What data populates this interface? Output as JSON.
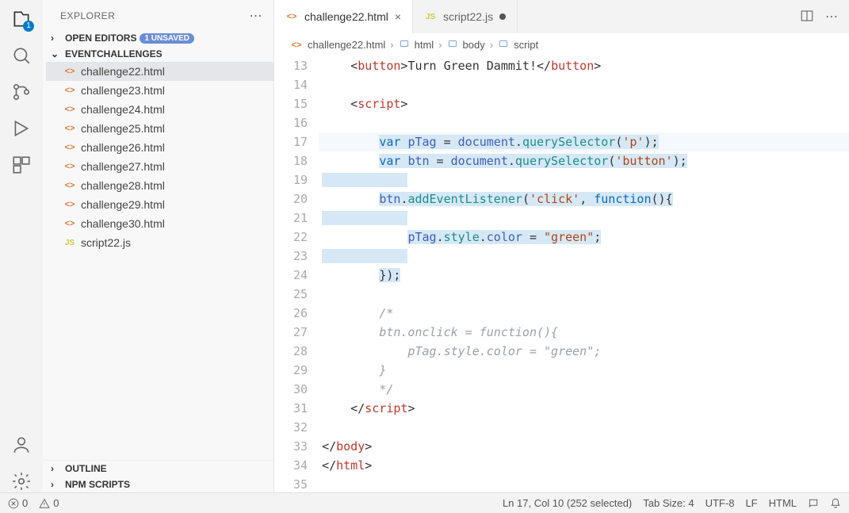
{
  "sidebar": {
    "title": "EXPLORER",
    "openEditors": "OPEN EDITORS",
    "unsaved": "1 UNSAVED",
    "folder": "EVENTCHALLENGES",
    "files": [
      {
        "name": "challenge22.html",
        "type": "html",
        "selected": true
      },
      {
        "name": "challenge23.html",
        "type": "html"
      },
      {
        "name": "challenge24.html",
        "type": "html"
      },
      {
        "name": "challenge25.html",
        "type": "html"
      },
      {
        "name": "challenge26.html",
        "type": "html"
      },
      {
        "name": "challenge27.html",
        "type": "html"
      },
      {
        "name": "challenge28.html",
        "type": "html"
      },
      {
        "name": "challenge29.html",
        "type": "html"
      },
      {
        "name": "challenge30.html",
        "type": "html"
      },
      {
        "name": "script22.js",
        "type": "js"
      }
    ],
    "outline": "OUTLINE",
    "npm": "NPM SCRIPTS"
  },
  "activityBadge": "1",
  "tabs": [
    {
      "name": "challenge22.html",
      "type": "html",
      "active": true,
      "dirty": false
    },
    {
      "name": "script22.js",
      "type": "js",
      "active": false,
      "dirty": true
    }
  ],
  "breadcrumb": [
    "challenge22.html",
    "html",
    "body",
    "script"
  ],
  "code": {
    "startLine": 13,
    "lines": [
      {
        "n": 13,
        "type": "buttonline"
      },
      {
        "n": 14,
        "type": "blank"
      },
      {
        "n": 15,
        "type": "scriptopen"
      },
      {
        "n": 16,
        "type": "blank-indent"
      },
      {
        "n": 17,
        "type": "l17"
      },
      {
        "n": 18,
        "type": "l18"
      },
      {
        "n": 19,
        "type": "blank-sel"
      },
      {
        "n": 20,
        "type": "l20"
      },
      {
        "n": 21,
        "type": "blank-sel"
      },
      {
        "n": 22,
        "type": "l22"
      },
      {
        "n": 23,
        "type": "blank-sel"
      },
      {
        "n": 24,
        "type": "l24"
      },
      {
        "n": 25,
        "type": "blank"
      },
      {
        "n": 26,
        "type": "c",
        "text": "/*"
      },
      {
        "n": 27,
        "type": "c",
        "text": "btn.onclick = function(){"
      },
      {
        "n": 28,
        "type": "c",
        "text": "    pTag.style.color = \"green\";"
      },
      {
        "n": 29,
        "type": "c",
        "text": "}"
      },
      {
        "n": 30,
        "type": "c",
        "text": "*/"
      },
      {
        "n": 31,
        "type": "scriptclose"
      },
      {
        "n": 32,
        "type": "blank"
      },
      {
        "n": 33,
        "type": "bodyclose"
      },
      {
        "n": 34,
        "type": "htmlclose"
      },
      {
        "n": 35,
        "type": "blank"
      }
    ],
    "tokens": {
      "button": "button",
      "turnGreen": "Turn Green Dammit!",
      "script": "script",
      "var": "var",
      "pTag": "pTag",
      "btn": "btn",
      "document": "document",
      "querySelector": "querySelector",
      "p": "'p'",
      "btnStr": "'button'",
      "addEventListener": "addEventListener",
      "click": "'click'",
      "function": "function",
      "style": "style",
      "color": "color",
      "green": "\"green\"",
      "body": "body",
      "html": "html"
    }
  },
  "status": {
    "errors": "0",
    "warnings": "0",
    "selection": "Ln 17, Col 10 (252 selected)",
    "tabSize": "Tab Size: 4",
    "encoding": "UTF-8",
    "eol": "LF",
    "lang": "HTML"
  }
}
